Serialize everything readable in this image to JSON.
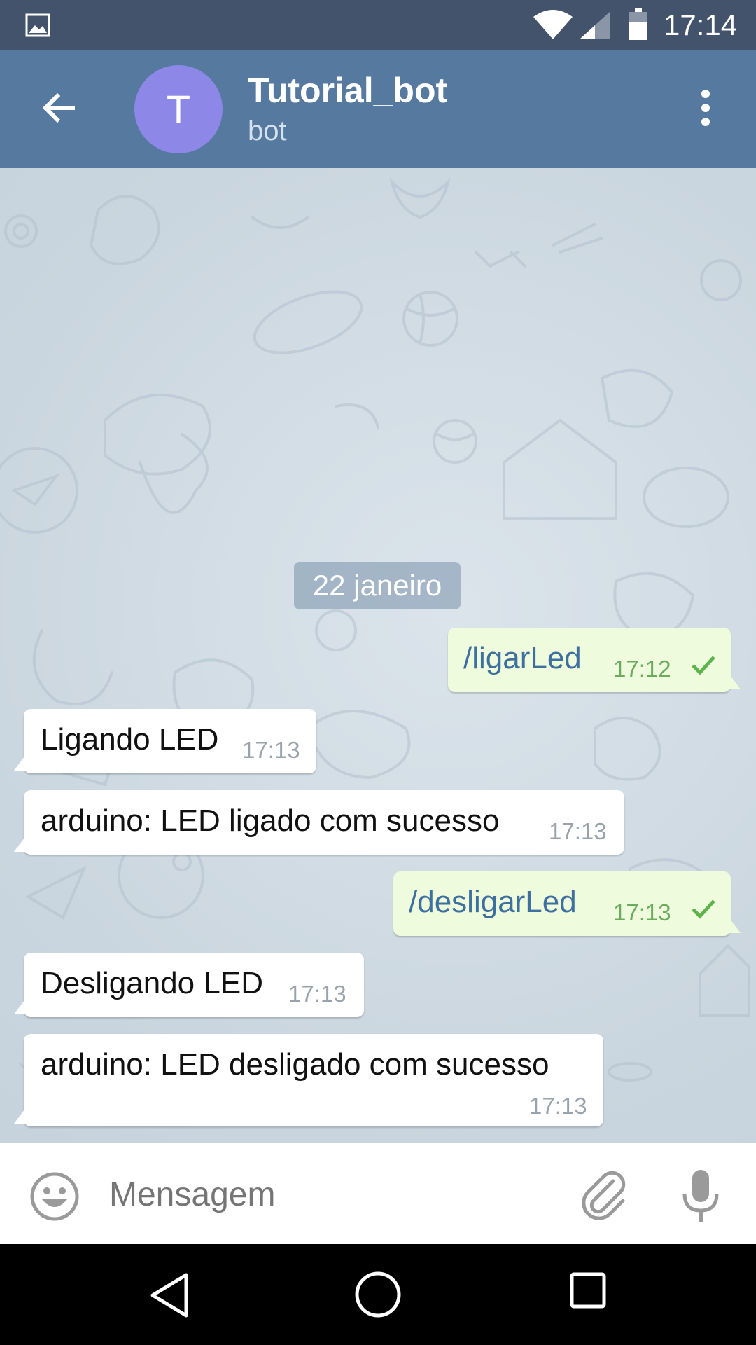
{
  "status_bar": {
    "time": "17:14",
    "icons": [
      "gallery-icon",
      "wifi-icon",
      "signal-icon",
      "battery-icon"
    ]
  },
  "header": {
    "avatar_letter": "T",
    "title": "Tutorial_bot",
    "subtitle": "bot",
    "colors": {
      "bar": "#5679a0",
      "avatar": "#8d88e8"
    }
  },
  "chat": {
    "date": "22 janeiro",
    "messages": [
      {
        "direction": "out",
        "text": "/ligarLed",
        "time": "17:12",
        "status": "sent"
      },
      {
        "direction": "in",
        "text": "Ligando LED",
        "time": "17:13"
      },
      {
        "direction": "in",
        "text": "arduino: LED ligado com sucesso",
        "time": "17:13"
      },
      {
        "direction": "out",
        "text": "/desligarLed",
        "time": "17:13",
        "status": "sent"
      },
      {
        "direction": "in",
        "text": "Desligando LED",
        "time": "17:13"
      },
      {
        "direction": "in",
        "text": "arduino: LED desligado com sucesso",
        "time": "17:13"
      }
    ],
    "colors": {
      "incoming": "#ffffff",
      "outgoing": "#eefbdc",
      "command_text": "#3d6f9f"
    }
  },
  "input": {
    "placeholder": "Mensagem"
  }
}
